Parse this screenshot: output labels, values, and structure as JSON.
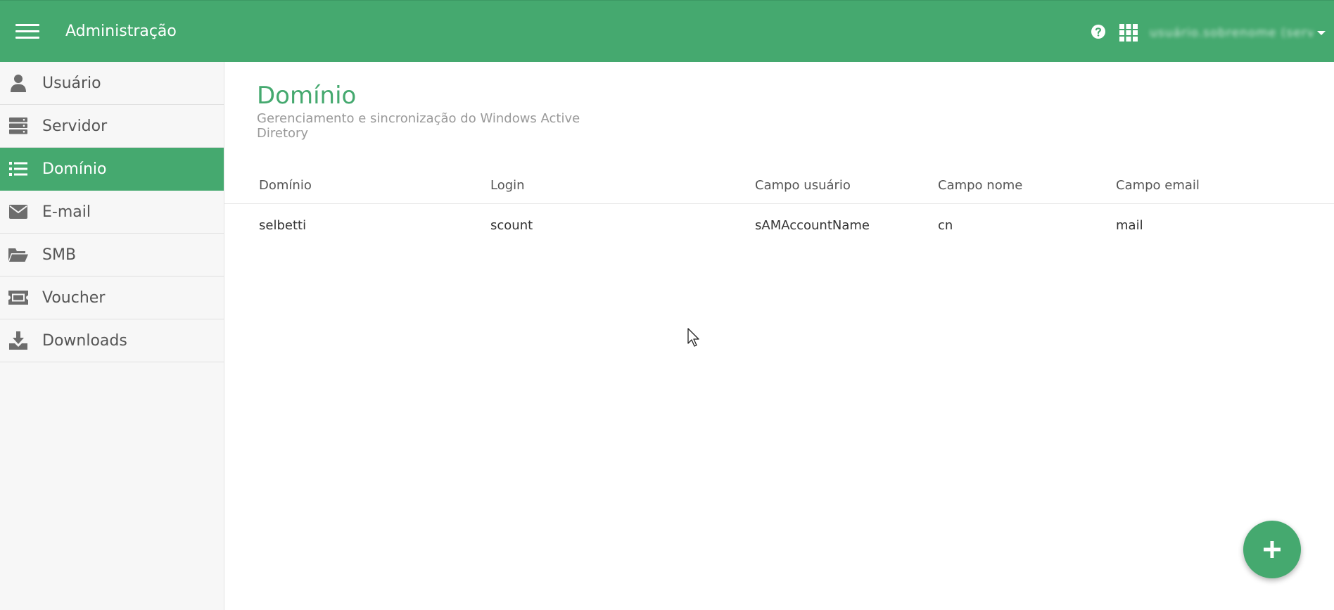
{
  "header": {
    "title": "Administração",
    "menu_icon": "hamburger-menu-icon",
    "help_icon": "question-circle-icon",
    "apps_icon": "grid-apps-icon",
    "user_name": "usuário.sobrenome (servidor)",
    "brand_color": "#45a96f"
  },
  "sidebar": {
    "items": [
      {
        "label": "Usuário",
        "icon": "user-icon",
        "active": false
      },
      {
        "label": "Servidor",
        "icon": "server-icon",
        "active": false
      },
      {
        "label": "Domínio",
        "icon": "list-icon",
        "active": true
      },
      {
        "label": "E-mail",
        "icon": "envelope-icon",
        "active": false
      },
      {
        "label": "SMB",
        "icon": "folder-open-icon",
        "active": false
      },
      {
        "label": "Voucher",
        "icon": "ticket-icon",
        "active": false
      },
      {
        "label": "Downloads",
        "icon": "download-icon",
        "active": false
      }
    ]
  },
  "main": {
    "title": "Domínio",
    "subtitle": "Gerenciamento e sincronização do Windows Active Diretory",
    "table": {
      "columns": [
        "Domínio",
        "Login",
        "Campo usuário",
        "Campo nome",
        "Campo email"
      ],
      "rows": [
        [
          "selbetti",
          "scount",
          "sAMAccountName",
          "cn",
          "mail"
        ]
      ]
    },
    "fab": {
      "icon": "plus-icon",
      "label": "+"
    }
  }
}
